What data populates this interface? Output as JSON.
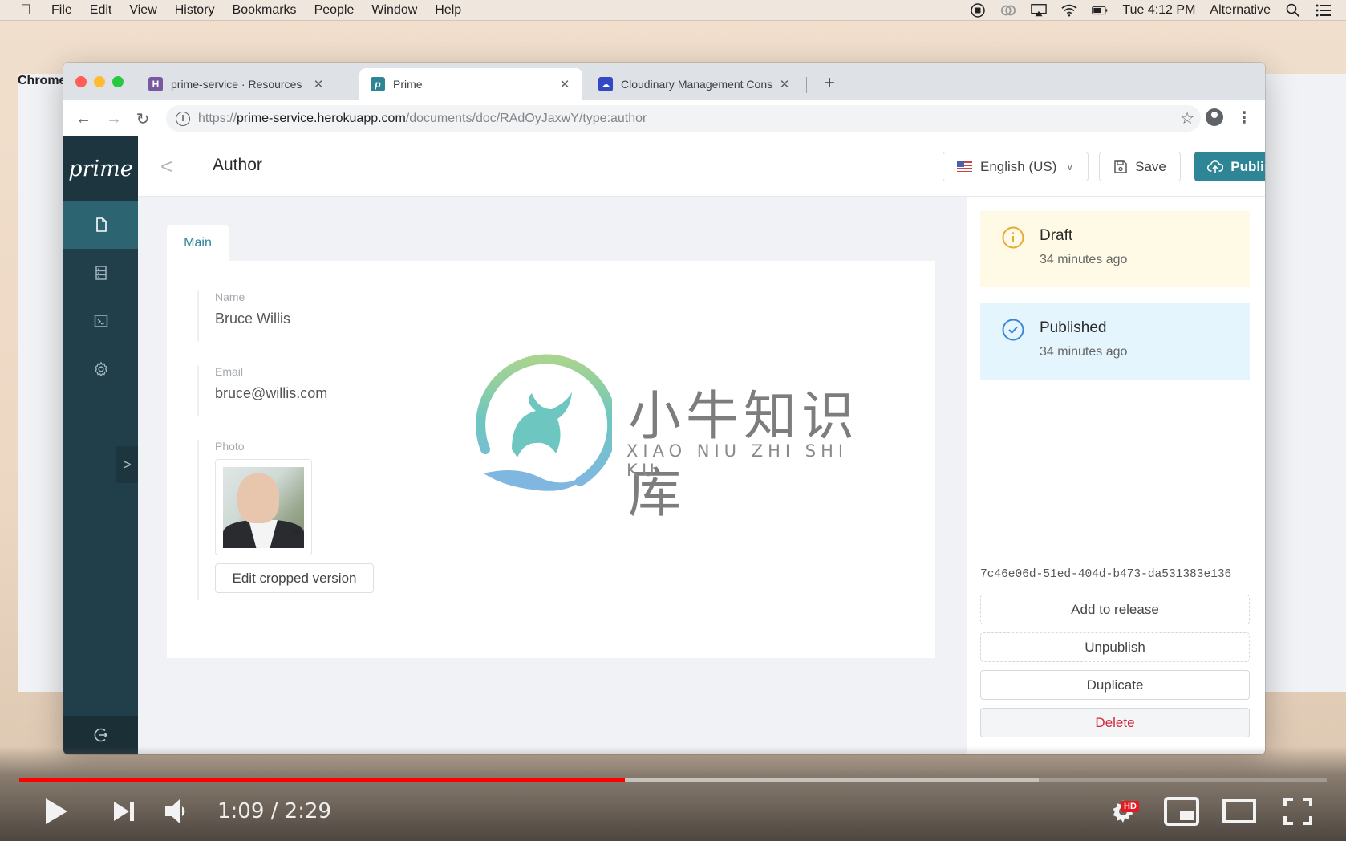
{
  "menubar": {
    "app": "Chrome",
    "items": [
      "File",
      "Edit",
      "View",
      "History",
      "Bookmarks",
      "People",
      "Window",
      "Help"
    ],
    "clock": "Tue 4:12 PM",
    "user": "Alternative"
  },
  "browser": {
    "tabs": [
      {
        "title": "prime-service · Resources | Heroku",
        "favicon": "heroku-icon",
        "favicon_letter": "H",
        "favicon_color": "#79589f",
        "active": false
      },
      {
        "title": "Prime",
        "favicon": "prime-icon",
        "favicon_letter": "p",
        "favicon_color": "#2e8596",
        "active": true
      },
      {
        "title": "Cloudinary Management Console",
        "favicon": "cloudinary-icon",
        "favicon_letter": "☁",
        "favicon_color": "#3448c5",
        "active": false
      }
    ],
    "url": {
      "scheme": "https://",
      "host": "prime-service.herokuapp.com",
      "path": "/documents/doc/RAdOyJaxwY/type:author"
    }
  },
  "app": {
    "logo": "prime",
    "sidebar": {
      "items": [
        {
          "name": "documents",
          "icon": "document-icon",
          "active": true
        },
        {
          "name": "schemas",
          "icon": "schema-list-icon",
          "active": false
        },
        {
          "name": "playground",
          "icon": "terminal-icon",
          "active": false
        },
        {
          "name": "settings",
          "icon": "gear-icon",
          "active": false
        }
      ],
      "toggle": ">",
      "bottom_icon": "logout-icon"
    },
    "header": {
      "title": "Author",
      "locale": "English (US)",
      "save_label": "Save",
      "publish_label": "Publish"
    },
    "tabs": [
      {
        "label": "Main",
        "active": true
      }
    ],
    "fields": [
      {
        "label": "Name",
        "value": "Bruce Willis"
      },
      {
        "label": "Email",
        "value": "bruce@willis.com"
      },
      {
        "label": "Photo",
        "value": ""
      }
    ],
    "photo_button": "Edit cropped version",
    "status": [
      {
        "type": "draft",
        "title": "Draft",
        "time": "34 minutes ago",
        "color": "#e8a93a"
      },
      {
        "type": "published",
        "title": "Published",
        "time": "34 minutes ago",
        "color": "#3b86d9"
      }
    ],
    "document_id": "7c46e06d-51ed-404d-b473-da531383e136",
    "actions": [
      "Add to release",
      "Unpublish",
      "Duplicate",
      "Delete"
    ]
  },
  "watermark": {
    "cn": "小牛知识库",
    "en": "XIAO NIU ZHI SHI KU"
  },
  "video": {
    "current_time": "1:09",
    "duration": "2:29",
    "time_display": "1:09 / 2:29",
    "played_fraction": 0.463,
    "buffered_fraction": 0.78,
    "quality_badge": "HD"
  }
}
